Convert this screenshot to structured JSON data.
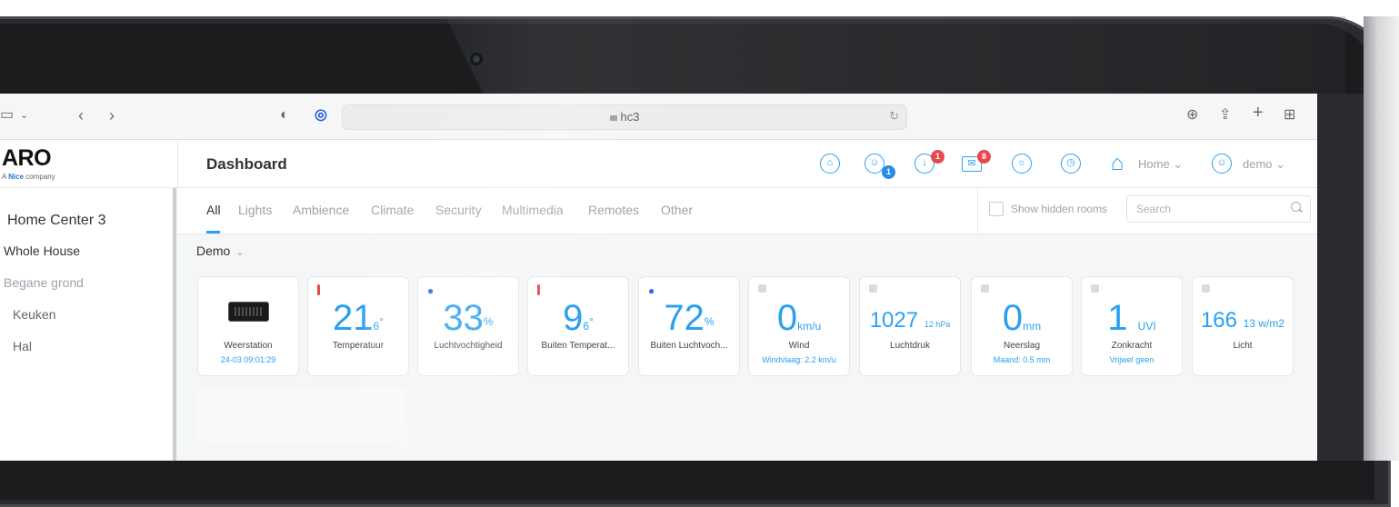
{
  "browser": {
    "url": "hc3"
  },
  "app": {
    "logo": "ARO",
    "logo_prefix": "A",
    "logo_brand": "Nice",
    "logo_suffix": "company",
    "page_title": "Dashboard",
    "home_label": "Home",
    "user_label": "demo",
    "badges": {
      "users": "1",
      "downloads": "1",
      "messages": "8"
    }
  },
  "sidebar": {
    "items": [
      {
        "label": "Home Center 3"
      },
      {
        "label": "Whole House"
      },
      {
        "label": "Begane grond"
      },
      {
        "label": "Keuken"
      },
      {
        "label": "Hal"
      }
    ]
  },
  "tabs": [
    {
      "label": "All"
    },
    {
      "label": "Lights"
    },
    {
      "label": "Ambience"
    },
    {
      "label": "Climate"
    },
    {
      "label": "Security"
    },
    {
      "label": "Multimedia"
    },
    {
      "label": "Remotes"
    },
    {
      "label": "Other"
    }
  ],
  "filter": {
    "show_hidden_label": "Show hidden rooms",
    "search_placeholder": "Search"
  },
  "room": {
    "name": "Demo"
  },
  "cards": [
    {
      "name": "Weerstation",
      "sub": "24-03 09:01:29"
    },
    {
      "value": "21",
      "unit": "6",
      "sup": "°",
      "name": "Temperatuur"
    },
    {
      "value": "33",
      "sup": "%",
      "name": "Luchtvochtigheid"
    },
    {
      "value": "9",
      "unit": "6",
      "sup": "°",
      "name": "Buiten Temperat..."
    },
    {
      "value": "72",
      "sup": "%",
      "name": "Buiten Luchtvoch..."
    },
    {
      "value": "0",
      "unit": "km/u",
      "name": "Wind",
      "sub": "Windvlaag: 2.2 km/u"
    },
    {
      "value": "1027",
      "unit": "12 hPa",
      "name": "Luchtdruk"
    },
    {
      "value": "0",
      "unit": "mm",
      "name": "Neerslag",
      "sub": "Maand: 0.5 mm"
    },
    {
      "value": "1",
      "unit": "UVI",
      "name": "Zonkracht",
      "sub": "Vrijwel geen"
    },
    {
      "value": "166",
      "unit": "13 w/m2",
      "name": "Licht"
    }
  ],
  "colors": {
    "accent": "#2aa0f0",
    "badge_red": "#e5484d",
    "badge_blue": "#2a8ae8"
  }
}
